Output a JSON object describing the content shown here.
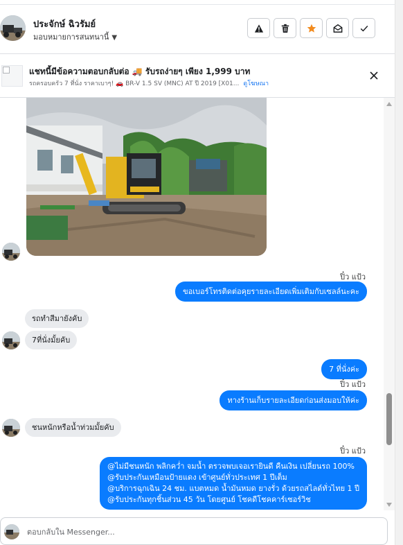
{
  "header": {
    "contact_name": "ประจักษ์ ฉิวรัมย์",
    "assign_label": "มอบหมายการสนทนานี้",
    "actions": [
      "spam-icon",
      "trash-icon",
      "star-icon",
      "mark-unread-icon",
      "check-icon"
    ]
  },
  "banner": {
    "title": "แชทนี้มีข้อความตอบกลับต่อ 🚚 รับรถง่ายๆ เพียง 1,999 บาท",
    "subtitle": "รถครอบครัว 7 ที่นั่ง ราคาเบาๆ! 🚗 BR-V 1.5 SV (MNC) AT ปี 2019 [X01...",
    "link": "ดูโฆษณา"
  },
  "messages": {
    "seen_1": "ปิ๋ว แป้ว",
    "out_1": "ขอเบอร์โทรติดต่อคุยรายละเอียดเพิ่มเติมกับเซลล์นะคะ",
    "in_1": "รถทำสีมายังคับ",
    "in_2": "7ที่นั่งมั้ยคับ",
    "out_2": "7 ที่นั่งค่ะ",
    "seen_2": "ปิ๋ว แป้ว",
    "out_3": "ทางร้านเก็บรายละเอียดก่อนส่งมอบให้ค่ะ",
    "in_3": "ชนหนักหรือน้ำท่วมมั้ยคับ",
    "seen_3": "ปิ๋ว แป้ว",
    "out_4": [
      "@ไม่มีชนหนัก พลิกคว่ำ จมน้ำ ตรวจพบเจอเรายินดี คืนเงิน เปลี่ยนรถ 100%",
      "@รับประกันเหมือนป้ายแดง เข้าศูนย์ทั่วประเทศ 1 ปีเต็ม",
      "@บริการฉุกเฉิน 24 ชม. แบตหมด น้ำมันหมด ยางรั่ว ด้วยรถสไลด์ทั่วไทย 1 ปี",
      "@รับประกันทุกชิ้นส่วน 45 วัน โดยศูนย์ โชคดีโชคคาร์เซอร์วิช"
    ]
  },
  "composer": {
    "placeholder": "ตอบกลับใน Messenger..."
  },
  "colors": {
    "outgoing_bubble": "#0a7cff",
    "incoming_bubble": "#e9ebee",
    "star": "#f28b1e",
    "link": "#1877f2"
  }
}
